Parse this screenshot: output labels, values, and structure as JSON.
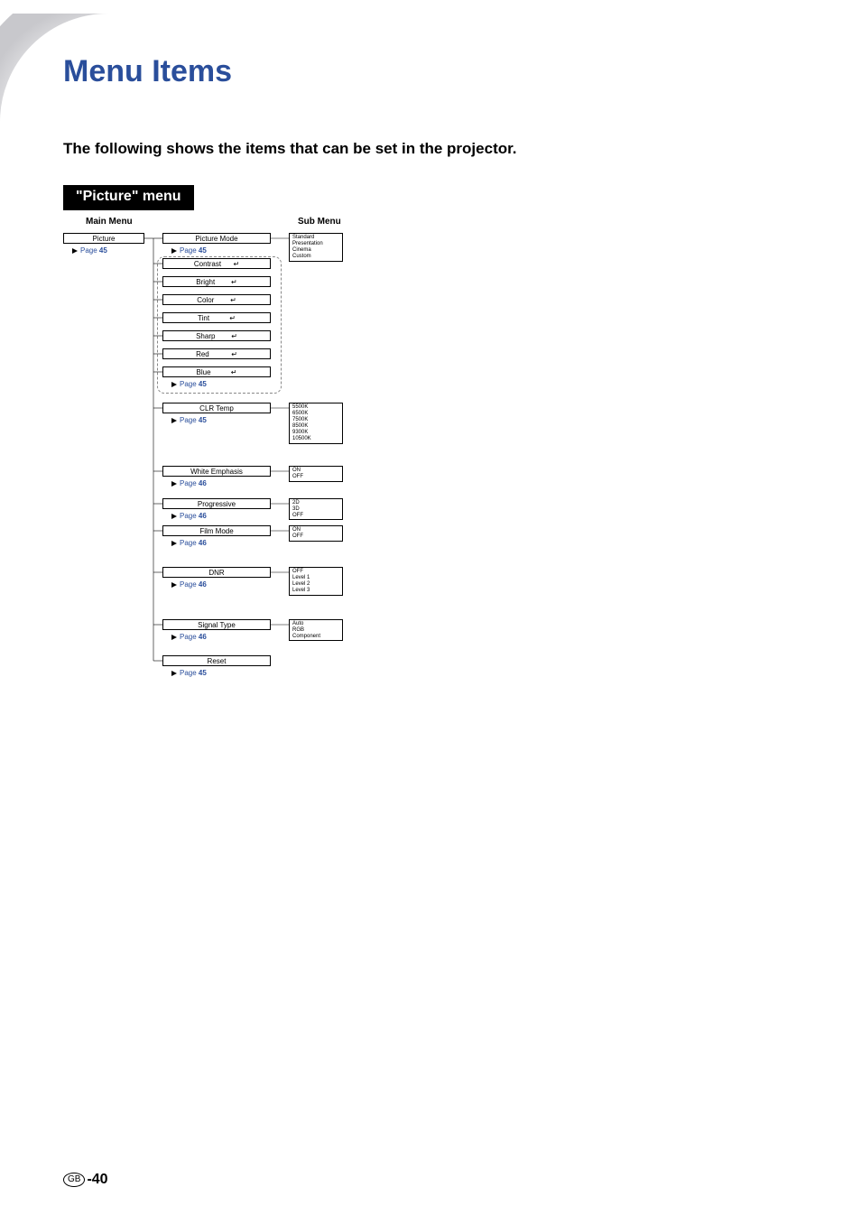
{
  "page_title": "Menu Items",
  "intro": "The following shows the items that can be set in the projector.",
  "section_heading": "\"Picture\" menu",
  "col_main": "Main Menu",
  "col_sub": "Sub Menu",
  "main_items": [
    {
      "label": "Picture",
      "page": "45"
    }
  ],
  "middle_items": [
    {
      "label": "Picture Mode",
      "page": "45"
    },
    {
      "label": "Contrast",
      "enter": true
    },
    {
      "label": "Bright",
      "enter": true
    },
    {
      "label": "Color",
      "enter": true
    },
    {
      "label": "Tint",
      "enter": true
    },
    {
      "label": "Sharp",
      "enter": true
    },
    {
      "label": "Red",
      "enter": true
    },
    {
      "label": "Blue",
      "enter": true,
      "page": "45"
    },
    {
      "label": "CLR Temp",
      "page": "45"
    },
    {
      "label": "White Emphasis",
      "page": "46"
    },
    {
      "label": "Progressive",
      "page": "46"
    },
    {
      "label": "Film Mode",
      "page": "46"
    },
    {
      "label": "DNR",
      "page": "46"
    },
    {
      "label": "Signal Type",
      "page": "46"
    },
    {
      "label": "Reset",
      "page": "45"
    }
  ],
  "submenus": [
    {
      "lines": [
        "Standard",
        "Presentation",
        "Cinema",
        "Custom"
      ]
    },
    {
      "lines": [
        "5500K",
        "6500K",
        "7500K",
        "8500K",
        "9300K",
        "10500K"
      ]
    },
    {
      "lines": [
        "ON",
        "OFF"
      ]
    },
    {
      "lines": [
        "2D",
        "3D",
        "OFF"
      ]
    },
    {
      "lines": [
        "ON",
        "OFF"
      ]
    },
    {
      "lines": [
        "OFF",
        "Level 1",
        "Level 2",
        "Level 3"
      ]
    },
    {
      "lines": [
        "Auto",
        "RGB",
        "Component"
      ]
    }
  ],
  "page_ref_prefix": "Page",
  "footer": {
    "region": "GB",
    "page_number": "-40"
  }
}
